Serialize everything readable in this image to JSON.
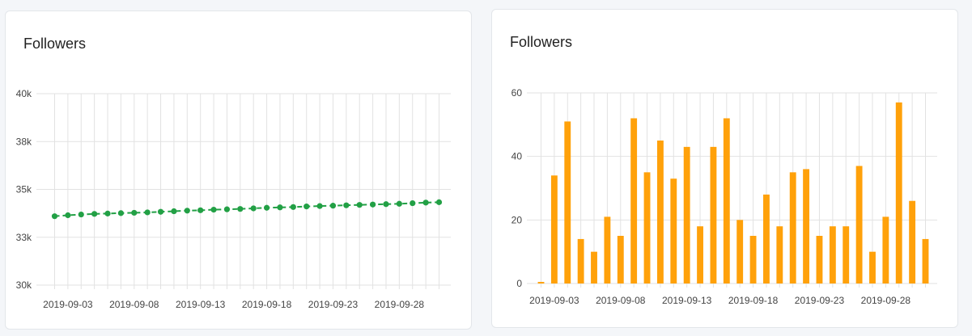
{
  "panels": [
    {
      "title": "Followers"
    },
    {
      "title": "Followers"
    }
  ],
  "colors": {
    "line": "#22a045",
    "bar": "#ffa10a",
    "grid": "#e2e2e2"
  },
  "chart_data": [
    {
      "type": "line",
      "title": "Followers",
      "xlabel": "",
      "ylabel": "",
      "x": [
        "2019-09-02",
        "2019-09-03",
        "2019-09-04",
        "2019-09-05",
        "2019-09-06",
        "2019-09-07",
        "2019-09-08",
        "2019-09-09",
        "2019-09-10",
        "2019-09-11",
        "2019-09-12",
        "2019-09-13",
        "2019-09-14",
        "2019-09-15",
        "2019-09-16",
        "2019-09-17",
        "2019-09-18",
        "2019-09-19",
        "2019-09-20",
        "2019-09-21",
        "2019-09-22",
        "2019-09-23",
        "2019-09-24",
        "2019-09-25",
        "2019-09-26",
        "2019-09-27",
        "2019-09-28",
        "2019-09-29",
        "2019-09-30",
        "2019-10-01"
      ],
      "x_tick_labels": [
        "2019-09-03",
        "2019-09-08",
        "2019-09-13",
        "2019-09-18",
        "2019-09-23",
        "2019-09-28"
      ],
      "y_ticks": [
        30000,
        32500,
        35000,
        37500,
        40000
      ],
      "y_tick_labels": [
        "30k",
        "33k",
        "35k",
        "38k",
        "40k"
      ],
      "ylim": [
        30000,
        40000
      ],
      "grid": true,
      "series": [
        {
          "values": [
            33600,
            33650,
            33690,
            33720,
            33740,
            33760,
            33780,
            33800,
            33830,
            33860,
            33890,
            33910,
            33940,
            33960,
            33980,
            34010,
            34040,
            34060,
            34080,
            34110,
            34130,
            34150,
            34170,
            34190,
            34210,
            34230,
            34250,
            34280,
            34310,
            34330
          ]
        }
      ]
    },
    {
      "type": "bar",
      "title": "Followers",
      "xlabel": "",
      "ylabel": "",
      "x": [
        "2019-09-02",
        "2019-09-03",
        "2019-09-04",
        "2019-09-05",
        "2019-09-06",
        "2019-09-07",
        "2019-09-08",
        "2019-09-09",
        "2019-09-10",
        "2019-09-11",
        "2019-09-12",
        "2019-09-13",
        "2019-09-14",
        "2019-09-15",
        "2019-09-16",
        "2019-09-17",
        "2019-09-18",
        "2019-09-19",
        "2019-09-20",
        "2019-09-21",
        "2019-09-22",
        "2019-09-23",
        "2019-09-24",
        "2019-09-25",
        "2019-09-26",
        "2019-09-27",
        "2019-09-28",
        "2019-09-29",
        "2019-09-30",
        "2019-10-01"
      ],
      "x_tick_labels": [
        "2019-09-03",
        "2019-09-08",
        "2019-09-13",
        "2019-09-18",
        "2019-09-23",
        "2019-09-28"
      ],
      "y_ticks": [
        0,
        20,
        40,
        60
      ],
      "y_tick_labels": [
        "0",
        "20",
        "40",
        "60"
      ],
      "ylim": [
        0,
        60
      ],
      "grid": true,
      "series": [
        {
          "values": [
            0.5,
            34,
            51,
            14,
            10,
            21,
            15,
            52,
            35,
            45,
            33,
            43,
            18,
            43,
            52,
            20,
            15,
            28,
            18,
            35,
            36,
            15,
            18,
            18,
            37,
            10,
            21,
            57,
            26,
            14
          ]
        }
      ]
    }
  ]
}
